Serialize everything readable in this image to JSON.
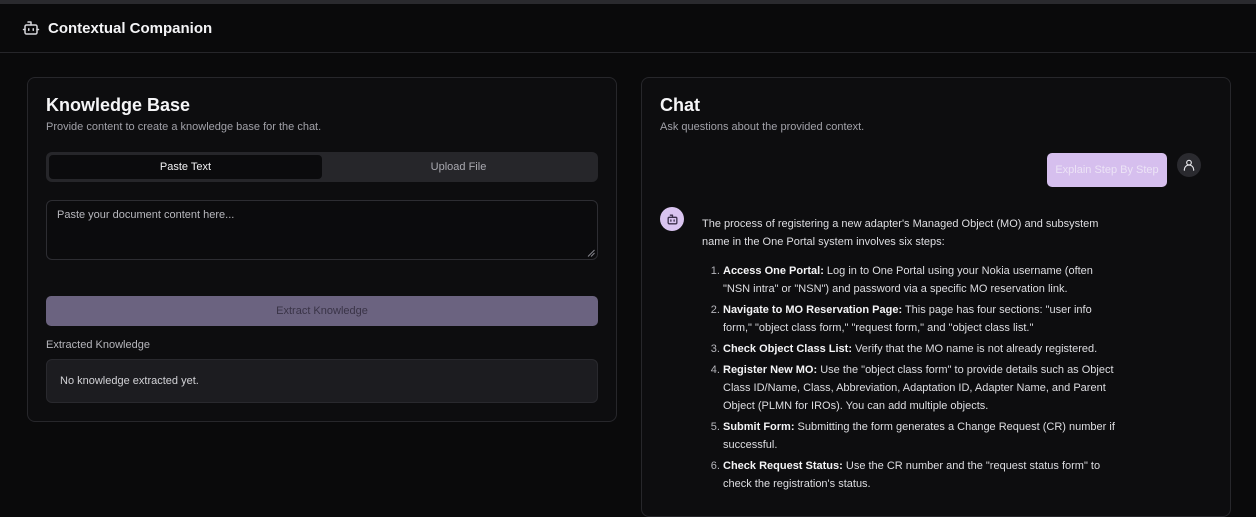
{
  "app": {
    "title": "Contextual Companion",
    "icon": "bot-icon"
  },
  "knowledge": {
    "title": "Knowledge Base",
    "subtitle": "Provide content to create a knowledge base for the chat.",
    "tabs": [
      {
        "label": "Paste Text",
        "active": true
      },
      {
        "label": "Upload File",
        "active": false
      }
    ],
    "textarea_placeholder": "Paste your document content here...",
    "extract_button": "Extract Knowledge",
    "extracted_label": "Extracted Knowledge",
    "extracted_value": "No knowledge extracted yet."
  },
  "chat": {
    "title": "Chat",
    "subtitle": "Ask questions about the provided context.",
    "user_message": "Explain Step By Step",
    "bot_intro": "The process of registering a new adapter's Managed Object (MO) and subsystem name in the One Portal system involves six steps:",
    "steps": [
      {
        "title": "Access One Portal:",
        "text": " Log in to One Portal using your Nokia username (often \"NSN intra\" or \"NSN\") and password via a specific MO reservation link."
      },
      {
        "title": "Navigate to MO Reservation Page:",
        "text": " This page has four sections: \"user info form,\" \"object class form,\" \"request form,\" and \"object class list.\""
      },
      {
        "title": "Check Object Class List:",
        "text": " Verify that the MO name is not already registered."
      },
      {
        "title": "Register New MO:",
        "text": " Use the \"object class form\" to provide details such as Object Class ID/Name, Class, Abbreviation, Adaptation ID, Adapter Name, and Parent Object (PLMN for IROs). You can add multiple objects."
      },
      {
        "title": "Submit Form:",
        "text": " Submitting the form generates a Change Request (CR) number if successful."
      },
      {
        "title": "Check Request Status:",
        "text": " Use the CR number and the \"request status form\" to check the registration's status."
      }
    ]
  },
  "colors": {
    "accent": "#d6bfee",
    "button_disabled": "#6b6380",
    "background": "#0a0a0b"
  }
}
